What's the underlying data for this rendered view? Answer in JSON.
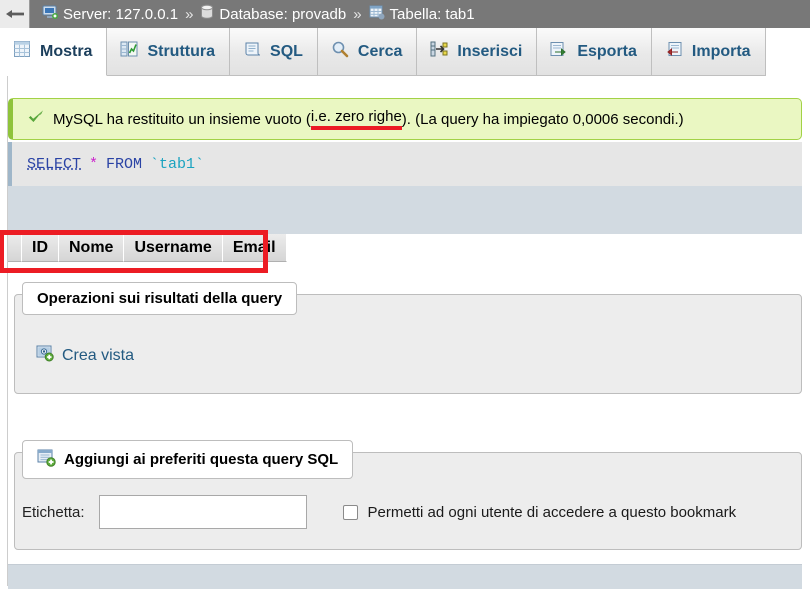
{
  "topbar": {
    "back_icon": "back-arrow-icon",
    "breadcrumbs": [
      {
        "icon": "server-icon",
        "label": "Server: 127.0.0.1"
      },
      {
        "icon": "database-icon",
        "label": "Database: provadb"
      },
      {
        "icon": "table-icon",
        "label": "Tabella: tab1"
      }
    ],
    "separator": "»"
  },
  "tabs": [
    {
      "icon": "browse-grid-icon",
      "label": "Mostra",
      "active": true
    },
    {
      "icon": "structure-icon",
      "label": "Struttura",
      "active": false
    },
    {
      "icon": "sql-scroll-icon",
      "label": "SQL",
      "active": false
    },
    {
      "icon": "magnifier-icon",
      "label": "Cerca",
      "active": false
    },
    {
      "icon": "insert-row-icon",
      "label": "Inserisci",
      "active": false
    },
    {
      "icon": "export-icon",
      "label": "Esporta",
      "active": false
    },
    {
      "icon": "import-icon",
      "label": "Importa",
      "active": false
    }
  ],
  "success": {
    "icon": "green-check-icon",
    "before": "MySQL ha restituito un insieme vuoto (",
    "highlighted": "i.e. zero righe",
    "after": "). (La query ha impiegato 0,0006 secondi.)"
  },
  "sql": {
    "keyword1": "SELECT",
    "star": "*",
    "keyword2": "FROM",
    "identifier": "`tab1`"
  },
  "results": {
    "columns": [
      "ID",
      "Nome",
      "Username",
      "Email"
    ],
    "rows": []
  },
  "operations": {
    "legend": "Operazioni sui risultati della query",
    "create_view": {
      "icon": "create-view-icon",
      "label": "Crea vista"
    }
  },
  "bookmark": {
    "legend_icon": "bookmark-add-icon",
    "legend": "Aggiungi ai preferiti questa query SQL",
    "label_text": "Etichetta:",
    "label_value": "",
    "label_placeholder": "",
    "checkbox_label": "Permetti ad ogni utente di accedere a questo bookmark",
    "checkbox_checked": false
  },
  "colors": {
    "topbar_bg": "#787878",
    "success_bg": "#eaf7c2",
    "success_border": "#a2d246",
    "annotation_red": "#ec1c24",
    "link_blue": "#235a81",
    "band_blue": "#d2dae1",
    "fieldset_bg": "#ededed"
  }
}
